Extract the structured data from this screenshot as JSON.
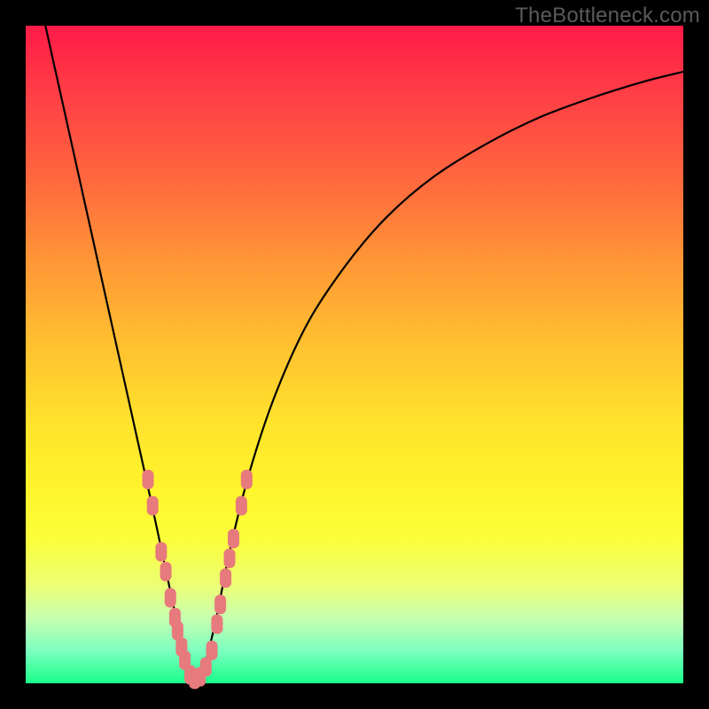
{
  "watermark": "TheBottleneck.com",
  "colors": {
    "frame": "#000000",
    "curve": "#000000",
    "marker_fill": "#e77a7c",
    "marker_stroke": "#d9666a"
  },
  "chart_data": {
    "type": "line",
    "title": "",
    "xlabel": "",
    "ylabel": "",
    "xlim": [
      0,
      100
    ],
    "ylim": [
      0,
      100
    ],
    "series": [
      {
        "name": "bottleneck-curve",
        "x": [
          3,
          5,
          7,
          9,
          11,
          13,
          15,
          17,
          19,
          20.5,
          22,
          23.3,
          24.5,
          25.7,
          27,
          29,
          31,
          34,
          38,
          43,
          49,
          55,
          62,
          70,
          78,
          86,
          94,
          100
        ],
        "y": [
          100,
          91,
          82,
          73,
          64,
          55,
          46,
          37,
          28,
          21,
          14,
          8,
          3,
          0.5,
          2,
          10,
          20,
          32,
          44,
          55,
          64,
          71,
          77,
          82,
          86,
          89,
          91.5,
          93
        ]
      }
    ],
    "markers": {
      "name": "highlight-points",
      "shape": "rounded-rect",
      "points": [
        {
          "x": 18.6,
          "y": 31
        },
        {
          "x": 19.3,
          "y": 27
        },
        {
          "x": 20.6,
          "y": 20
        },
        {
          "x": 21.3,
          "y": 17
        },
        {
          "x": 22.0,
          "y": 13
        },
        {
          "x": 22.7,
          "y": 10
        },
        {
          "x": 23.1,
          "y": 8
        },
        {
          "x": 23.7,
          "y": 5.5
        },
        {
          "x": 24.2,
          "y": 3.5
        },
        {
          "x": 25.0,
          "y": 1.3
        },
        {
          "x": 25.7,
          "y": 0.6
        },
        {
          "x": 26.5,
          "y": 1.0
        },
        {
          "x": 27.4,
          "y": 2.5
        },
        {
          "x": 28.3,
          "y": 5
        },
        {
          "x": 29.1,
          "y": 9
        },
        {
          "x": 29.6,
          "y": 12
        },
        {
          "x": 30.4,
          "y": 16
        },
        {
          "x": 31.0,
          "y": 19
        },
        {
          "x": 31.6,
          "y": 22
        },
        {
          "x": 32.8,
          "y": 27
        },
        {
          "x": 33.6,
          "y": 31
        }
      ]
    }
  }
}
